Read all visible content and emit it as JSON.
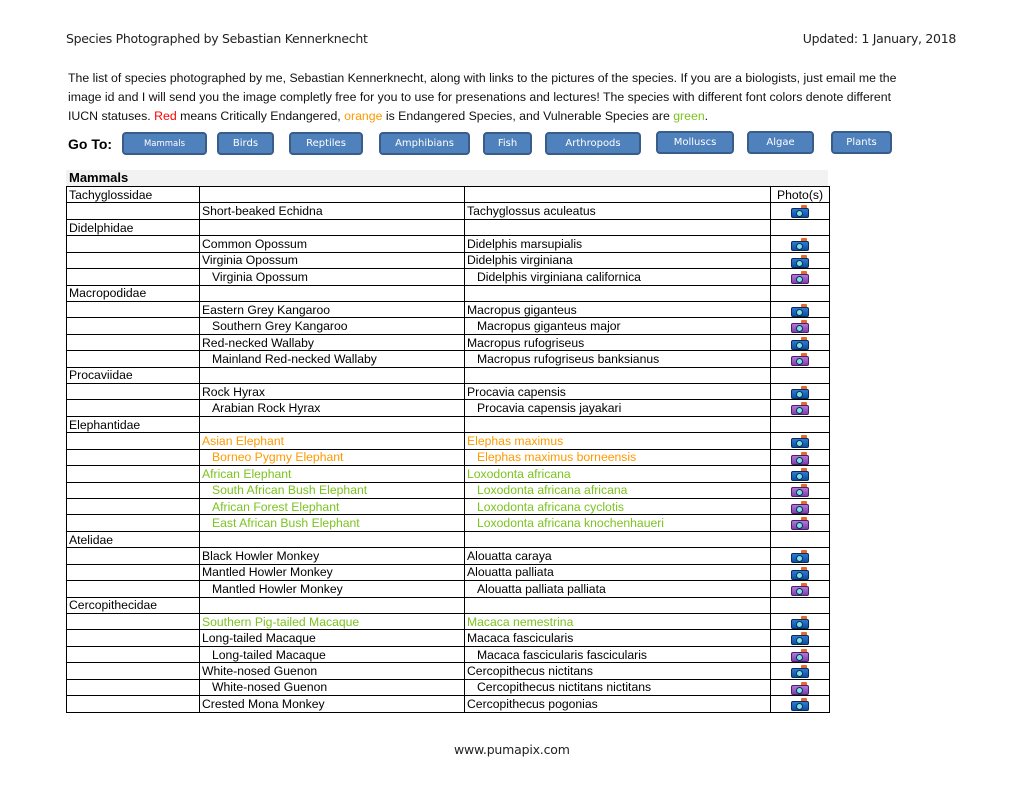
{
  "header": {
    "title": "Species Photographed by Sebastian Kennerknecht",
    "updated": "Updated: 1 January, 2018"
  },
  "intro": {
    "text_1": "The list of species photographed by me, Sebastian Kennerknecht, along with links to the pictures of the species. If you are a biologists, just email me the image id and I will send you the image completly free for you to use for presenations and lectures! The species with different font colors denote different IUCN statuses. ",
    "red_word": "Red",
    "text_2": " means Critically Endangered, ",
    "orange_word": "orange",
    "text_3": " is Endangered Species, and Vulnerable Species are ",
    "green_word": "green",
    "text_4": "."
  },
  "status_colors": {
    "critically_endangered": "#ff0000",
    "endangered": "#ff9900",
    "vulnerable": "#7cc31f"
  },
  "nav": {
    "label": "Go To:",
    "buttons": [
      {
        "label": "Mammals"
      },
      {
        "label": "Birds"
      },
      {
        "label": "Reptiles"
      },
      {
        "label": "Amphibians"
      },
      {
        "label": "Fish"
      },
      {
        "label": "Arthropods"
      },
      {
        "label": "Molluscs"
      },
      {
        "label": "Algae"
      },
      {
        "label": "Plants"
      }
    ]
  },
  "section": {
    "title": "Mammals",
    "photo_header": "Photo(s)",
    "rows": [
      {
        "type": "family",
        "family": "Tachyglossidae",
        "photo_header": true
      },
      {
        "type": "species",
        "common": "Short-beaked Echidna",
        "scientific": "Tachyglossus aculeatus",
        "status": "",
        "camera": "species"
      },
      {
        "type": "family",
        "family": "Didelphidae"
      },
      {
        "type": "species",
        "common": "Common Opossum",
        "scientific": "Didelphis marsupialis",
        "status": "",
        "camera": "species"
      },
      {
        "type": "species",
        "common": "Virginia Opossum",
        "scientific": "Didelphis virginiana",
        "status": "",
        "camera": "species"
      },
      {
        "type": "subspecies",
        "common": "Virginia Opossum",
        "scientific": "Didelphis virginiana californica",
        "status": "",
        "camera": "subspecies"
      },
      {
        "type": "family",
        "family": "Macropodidae"
      },
      {
        "type": "species",
        "common": "Eastern Grey Kangaroo",
        "scientific": "Macropus giganteus",
        "status": "",
        "camera": "species"
      },
      {
        "type": "subspecies",
        "common": "Southern Grey Kangaroo",
        "scientific": "Macropus giganteus major",
        "status": "",
        "camera": "subspecies"
      },
      {
        "type": "species",
        "common": "Red-necked Wallaby",
        "scientific": "Macropus rufogriseus",
        "status": "",
        "camera": "species"
      },
      {
        "type": "subspecies",
        "common": "Mainland Red-necked Wallaby",
        "scientific": "Macropus rufogriseus banksianus",
        "status": "",
        "camera": "subspecies"
      },
      {
        "type": "family",
        "family": "Procaviidae"
      },
      {
        "type": "species",
        "common": "Rock Hyrax",
        "scientific": "Procavia capensis",
        "status": "",
        "camera": "species"
      },
      {
        "type": "subspecies",
        "common": "Arabian Rock Hyrax",
        "scientific": "Procavia capensis jayakari",
        "status": "",
        "camera": "subspecies"
      },
      {
        "type": "family",
        "family": "Elephantidae"
      },
      {
        "type": "species",
        "common": "Asian Elephant",
        "scientific": "Elephas maximus",
        "status": "EN",
        "camera": "species"
      },
      {
        "type": "subspecies",
        "common": "Borneo Pygmy Elephant",
        "scientific": "Elephas maximus borneensis",
        "status": "EN",
        "camera": "subspecies"
      },
      {
        "type": "species",
        "common": "African Elephant",
        "scientific": "Loxodonta africana",
        "status": "VU",
        "camera": "species"
      },
      {
        "type": "subspecies",
        "common": "South African Bush Elephant",
        "scientific": "Loxodonta africana africana",
        "status": "VU",
        "camera": "subspecies"
      },
      {
        "type": "subspecies",
        "common": "African Forest Elephant",
        "scientific": "Loxodonta africana cyclotis",
        "status": "VU",
        "camera": "subspecies"
      },
      {
        "type": "subspecies",
        "common": "East African Bush Elephant",
        "scientific": "Loxodonta africana knochenhaueri",
        "status": "VU",
        "camera": "subspecies"
      },
      {
        "type": "family",
        "family": "Atelidae"
      },
      {
        "type": "species",
        "common": "Black Howler Monkey",
        "scientific": "Alouatta caraya",
        "status": "",
        "camera": "species"
      },
      {
        "type": "species",
        "common": "Mantled Howler Monkey",
        "scientific": "Alouatta palliata",
        "status": "",
        "camera": "species"
      },
      {
        "type": "subspecies",
        "common": "Mantled Howler Monkey",
        "scientific": "Alouatta palliata palliata",
        "status": "",
        "camera": "subspecies"
      },
      {
        "type": "family",
        "family": "Cercopithecidae"
      },
      {
        "type": "species",
        "common": "Southern Pig-tailed Macaque",
        "scientific": "Macaca nemestrina",
        "status": "VU",
        "camera": "species"
      },
      {
        "type": "species",
        "common": "Long-tailed Macaque",
        "scientific": "Macaca fascicularis",
        "status": "",
        "camera": "species"
      },
      {
        "type": "subspecies",
        "common": "Long-tailed Macaque",
        "scientific": "Macaca fascicularis fascicularis",
        "status": "",
        "camera": "subspecies"
      },
      {
        "type": "species",
        "common": "White-nosed Guenon",
        "scientific": "Cercopithecus nictitans",
        "status": "",
        "camera": "species"
      },
      {
        "type": "subspecies",
        "common": "White-nosed Guenon",
        "scientific": "Cercopithecus nictitans nictitans",
        "status": "",
        "camera": "subspecies"
      },
      {
        "type": "species",
        "common": "Crested Mona Monkey",
        "scientific": "Cercopithecus pogonias",
        "status": "",
        "camera": "species"
      }
    ]
  },
  "footer": {
    "url": "www.pumapix.com"
  }
}
